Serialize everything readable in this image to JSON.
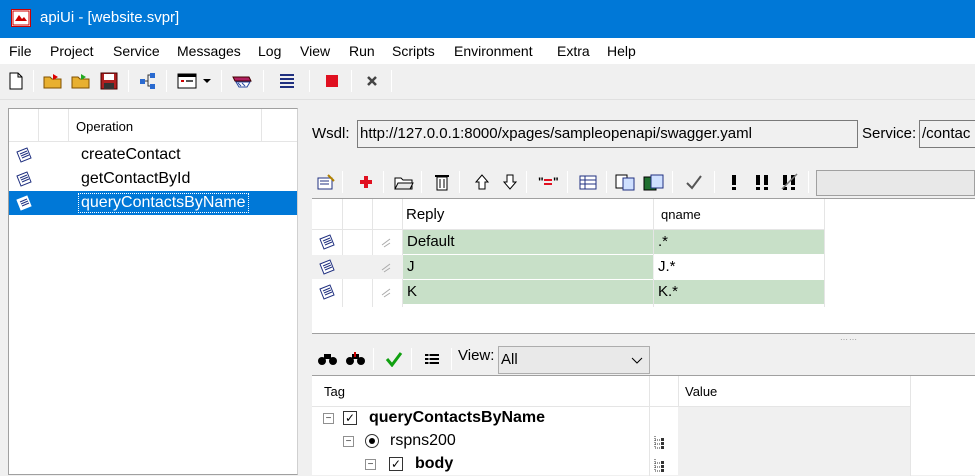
{
  "window": {
    "title": "apiUi - [website.svpr]"
  },
  "menu": [
    "File",
    "Project",
    "Service",
    "Messages",
    "Log",
    "View",
    "Run",
    "Scripts",
    "Environment",
    "Extra",
    "Help"
  ],
  "operations": {
    "header": "Operation",
    "items": [
      {
        "name": "createContact",
        "selected": false
      },
      {
        "name": "getContactById",
        "selected": false
      },
      {
        "name": "queryContactsByName",
        "selected": true
      }
    ]
  },
  "wsdl": {
    "label": "Wsdl:",
    "value": "http://127.0.0.1:8000/xpages/sampleopenapi/swagger.yaml",
    "service_label": "Service:",
    "service_value": "/contac"
  },
  "replies": {
    "headers": [
      "Reply",
      "qname"
    ],
    "rows": [
      {
        "reply": "Default",
        "qname": ".*"
      },
      {
        "reply": "J",
        "qname": "J.*"
      },
      {
        "reply": "K",
        "qname": "K.*"
      }
    ],
    "row_color": "#c8e0c8"
  },
  "view": {
    "label": "View:",
    "selected": "All"
  },
  "tree": {
    "headers": [
      "Tag",
      "Value"
    ],
    "rows": [
      {
        "label": "queryContactsByName",
        "bold": true,
        "control": "checkbox"
      },
      {
        "label": "rspns200",
        "bold": false,
        "control": "radio"
      },
      {
        "label": "body",
        "bold": true,
        "control": "checkbox"
      }
    ]
  },
  "colors": {
    "titlebar": "#0078d7",
    "selection": "#0078d7"
  }
}
